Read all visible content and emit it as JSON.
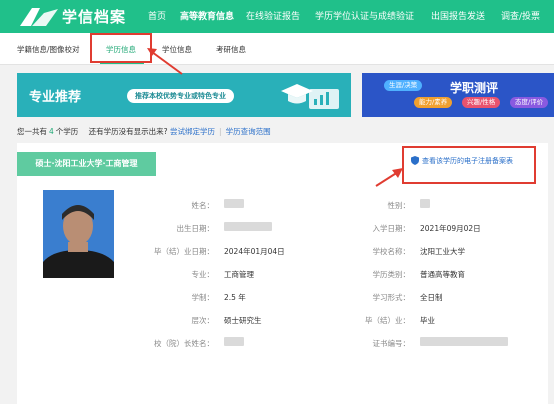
{
  "brand": {
    "name": "学信档案"
  },
  "topnav": [
    "首页",
    "高等教育信息",
    "在线验证报告",
    "学历学位认证与成绩验证",
    "出国报告发送",
    "调查/投票"
  ],
  "subnav": [
    "学籍信息/图像校对",
    "学历信息",
    "学位信息",
    "考研信息"
  ],
  "banner_left": {
    "title": "专业推荐",
    "pill": "推荐本校优势专业或特色专业"
  },
  "banner_right": {
    "title": "学职测评",
    "tags": [
      "生涯/决策",
      "能力/素养",
      "兴趣/性格",
      "态度/评价"
    ]
  },
  "info": {
    "prefix": "您一共有",
    "count": "4",
    "suffix": "个学历",
    "question": "还有学历没有显示出来?",
    "bind_link": "尝试绑定学历",
    "range_link": "学历查询范围"
  },
  "record": {
    "tab": "硕士·沈阳工业大学·工商管理",
    "report_link": "查看该学历的电子注册备案表",
    "labels": {
      "name": "姓名：",
      "gender": "性别：",
      "birth": "出生日期：",
      "enroll": "入学日期：",
      "graduate": "毕（结）业日期：",
      "school": "学校名称：",
      "major": "专业：",
      "category": "学历类别：",
      "duration": "学制：",
      "form": "学习形式：",
      "level": "层次：",
      "conclusion": "毕（结）业：",
      "president": "校（院）长姓名：",
      "cert_no": "证书编号："
    },
    "values": {
      "enroll": "2021年09月02日",
      "graduate": "2024年01月04日",
      "school": "沈阳工业大学",
      "major": "工商管理",
      "category": "普通高等教育",
      "duration": "2.5 年",
      "form": "全日制",
      "level": "硕士研究生",
      "conclusion": "毕业"
    }
  },
  "colors": {
    "nav": "#20c08a",
    "accent": "#20a876",
    "link": "#2a6fc9",
    "highlight": "#e03c31",
    "tab": "#5fcba0"
  }
}
